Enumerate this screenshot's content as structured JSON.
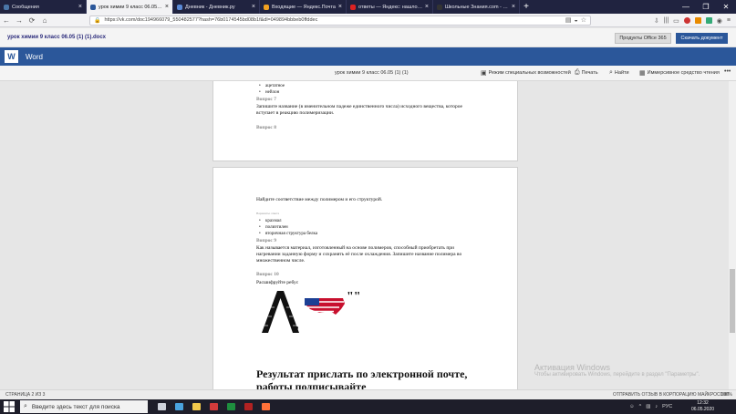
{
  "browser": {
    "tabs": [
      {
        "label": "Сообщения",
        "color": "#4a76a8",
        "active": false
      },
      {
        "label": "урок химии 9 класс 06.05 (1) (1).docx",
        "color": "#2b579a",
        "active": true
      },
      {
        "label": "Дневник - Дневник.ру",
        "color": "#5a8ad6",
        "active": false
      },
      {
        "label": "Входящие — Яндекс.Почта",
        "color": "#f0a020",
        "active": false
      },
      {
        "label": "ответы — Яндекс: нашлось 2…",
        "color": "#d22",
        "active": false
      },
      {
        "label": "Школьные Знания.com - Ре…",
        "color": "#333",
        "active": false
      }
    ],
    "url": "https://vk.com/doc194966079_550482577?hash=76b0174545bd08b1f&dl=049894bbbeb0ffddec",
    "window_buttons": [
      "—",
      "❐",
      "✕"
    ]
  },
  "docbar": {
    "filename": "урок химии 9 класс 06.05 (1) (1).docx",
    "office_button": "Продукты Office 365",
    "download_button": "Скачать документ"
  },
  "word": {
    "app_name": "Word",
    "logo": "W",
    "doc_title": "урок химии 9 класс 06.05 (1) (1)",
    "commands": {
      "accessibility": "Режим специальных возможностей",
      "print": "Печать",
      "find": "Найти",
      "reader": "Иммерсивное средство чтения"
    }
  },
  "page1": {
    "bullets": [
      "ацетатное",
      "нейлон"
    ],
    "q7_label": "Вопрос 7",
    "q7_text_1": "Запишите название (в именительном падеже единственного числа) исходного вещества, которое",
    "q7_text_2": "вступает в реакцию полимеризации.",
    "q8_label": "Вопрос 8"
  },
  "page2": {
    "q8_text": "Найдите соответствие между полимером и его структурой.",
    "small_label": "Варианты ответа",
    "bullets": [
      "крахмал",
      "полиэтилен",
      "вторичная структура белка"
    ],
    "q9_label": "Вопрос 9",
    "q9_text_1": "Как называется материал, изготовленный на основе полимеров, способный приобретать при",
    "q9_text_2": "нагревании заданную форму и сохранять её после охлаждения. Запишите название полимера во",
    "q9_text_3": "множественном числе.",
    "q10_label": "Вопрос 10",
    "q10_text": "Расшифруйте ребус",
    "rebus_quotes": "\"\"",
    "big_line_1": "Результат   прислать по электронной почте,",
    "big_line_2": "работы подписывайте"
  },
  "watermark": {
    "title": "Активация Windows",
    "subtitle": "Чтобы активировать Windows, перейдите в раздел \"Параметры\"."
  },
  "status": {
    "page": "СТРАНИЦА 2 ИЗ 3",
    "feedback": "ОТПРАВИТЬ ОТЗЫВ В КОРПОРАЦИЮ МАЙКРОСОФТ",
    "zoom": "100%"
  },
  "taskbar": {
    "search_placeholder": "Введите здесь текст для поиска",
    "apps": [
      {
        "name": "task-view",
        "color": "#cfd3dc"
      },
      {
        "name": "desktop",
        "color": "#4aa3df"
      },
      {
        "name": "explorer",
        "color": "#f2c94c"
      },
      {
        "name": "app-red",
        "color": "#d23b3b"
      },
      {
        "name": "app-green",
        "color": "#1e8e3e"
      },
      {
        "name": "app-darkred",
        "color": "#b22222"
      },
      {
        "name": "firefox",
        "color": "#ff7139"
      }
    ],
    "lang": "РУС",
    "time": "12:32",
    "date": "06.05.2020"
  }
}
